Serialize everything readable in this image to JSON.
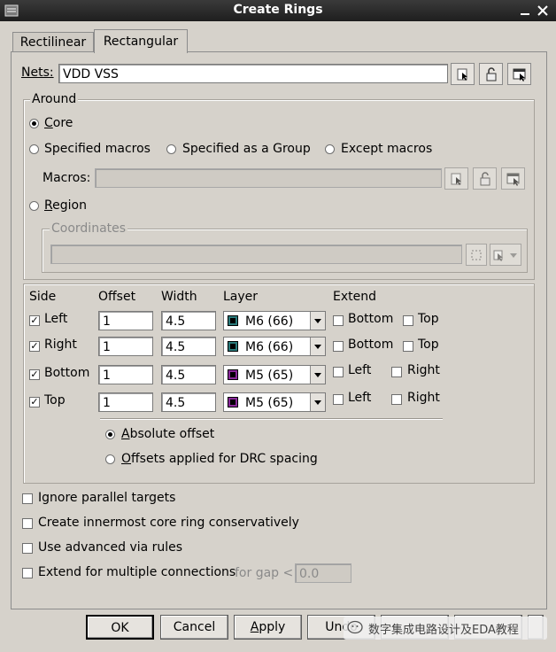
{
  "window": {
    "title": "Create Rings"
  },
  "tabs": [
    {
      "label": "Rectilinear"
    },
    {
      "label": "Rectangular"
    }
  ],
  "nets": {
    "label": "Nets:",
    "value": "VDD VSS"
  },
  "around": {
    "title": "Around",
    "core_label": "Core",
    "specified_macros_label": "Specified macros",
    "specified_group_label": "Specified as a Group",
    "except_macros_label": "Except macros",
    "macros_label": "Macros:",
    "macros_value": "",
    "region_label": "Region",
    "coordinates_label": "Coordinates",
    "coordinates_value": "",
    "selected": "Core"
  },
  "table": {
    "headers": {
      "side": "Side",
      "offset": "Offset",
      "width": "Width",
      "layer": "Layer",
      "extend": "Extend"
    },
    "rows": [
      {
        "side": "Left",
        "checked": true,
        "offset": "1",
        "width": "4.5",
        "layer": "M6 (66)",
        "ext1": "Bottom",
        "ext2": "Top",
        "color": "#2a7a7a"
      },
      {
        "side": "Right",
        "checked": true,
        "offset": "1",
        "width": "4.5",
        "layer": "M6 (66)",
        "ext1": "Bottom",
        "ext2": "Top",
        "color": "#2a7a7a"
      },
      {
        "side": "Bottom",
        "checked": true,
        "offset": "1",
        "width": "4.5",
        "layer": "M5 (65)",
        "ext1": "Left",
        "ext2": "Right",
        "color": "#8a2a9a"
      },
      {
        "side": "Top",
        "checked": true,
        "offset": "1",
        "width": "4.5",
        "layer": "M5 (65)",
        "ext1": "Left",
        "ext2": "Right",
        "color": "#8a2a9a"
      }
    ],
    "absolute_offset_label": "Absolute offset",
    "drc_offset_label": "Offsets applied for DRC spacing"
  },
  "options": {
    "ignore_parallel": "Ignore parallel targets",
    "innermost": "Create innermost core ring conservatively",
    "advanced_via": "Use advanced via rules",
    "extend_multi": "Extend for multiple connections",
    "gap_label": "for gap <",
    "gap_value": "0.0"
  },
  "buttons": {
    "ok": "OK",
    "cancel": "Cancel",
    "apply": "Apply",
    "undo": "Undo"
  },
  "watermark": "数字集成电路设计及EDA教程"
}
